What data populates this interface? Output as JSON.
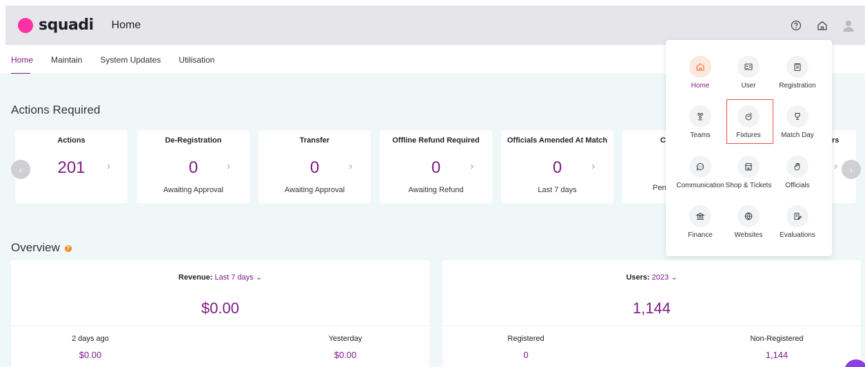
{
  "header": {
    "logo_text": "squadi",
    "title": "Home",
    "brand_color": "#ff2fa5",
    "icons": [
      "help-circle-icon",
      "home-icon",
      "user-avatar-icon"
    ]
  },
  "nav": {
    "tabs": [
      {
        "label": "Home",
        "active": true
      },
      {
        "label": "Maintain",
        "active": false
      },
      {
        "label": "System Updates",
        "active": false
      },
      {
        "label": "Utilisation",
        "active": false
      }
    ]
  },
  "actions": {
    "title": "Actions Required",
    "cards": [
      {
        "title": "Actions",
        "value": "201",
        "sub": ""
      },
      {
        "title": "De-Registration",
        "value": "0",
        "sub": "Awaiting Approval"
      },
      {
        "title": "Transfer",
        "value": "0",
        "sub": "Awaiting Approval"
      },
      {
        "title": "Offline Refund Required",
        "value": "0",
        "sub": "Awaiting Refund"
      },
      {
        "title": "Officials Amended At Match",
        "value": "0",
        "sub": "Last 7 days"
      },
      {
        "title": "Cl",
        "value": "",
        "sub": "Pen"
      },
      {
        "title": "rs",
        "value": "",
        "sub": ""
      }
    ]
  },
  "overview": {
    "title": "Overview",
    "revenue": {
      "label": "Revenue:",
      "period": "Last 7 days",
      "total": "$0.00",
      "stats": [
        {
          "label": "2 days ago",
          "value": "$0.00"
        },
        {
          "label": "Yesterday",
          "value": "$0.00"
        }
      ]
    },
    "users": {
      "label": "Users:",
      "period": "2023",
      "total": "1,144",
      "stats": [
        {
          "label": "Registered",
          "value": "0"
        },
        {
          "label": "Non-Registered",
          "value": "1,144"
        }
      ]
    }
  },
  "app_menu": {
    "items": [
      {
        "label": "Home",
        "icon": "home-icon",
        "active": true
      },
      {
        "label": "User",
        "icon": "id-card-icon",
        "active": false
      },
      {
        "label": "Registration",
        "icon": "clipboard-icon",
        "active": false
      },
      {
        "label": "Teams",
        "icon": "team-icon",
        "active": false
      },
      {
        "label": "Fixtures",
        "icon": "fixtures-ball-icon",
        "active": false,
        "highlighted": true
      },
      {
        "label": "Match Day",
        "icon": "trophy-icon",
        "active": false
      },
      {
        "label": "Communication",
        "icon": "chat-bubble-icon",
        "active": false
      },
      {
        "label": "Shop & Tickets",
        "icon": "shop-icon",
        "active": false
      },
      {
        "label": "Officials",
        "icon": "hand-icon",
        "active": false
      },
      {
        "label": "Finance",
        "icon": "bank-icon",
        "active": false
      },
      {
        "label": "Websites",
        "icon": "globe-icon",
        "active": false
      },
      {
        "label": "Evaluations",
        "icon": "edit-note-icon",
        "active": false
      }
    ]
  },
  "colors": {
    "accent": "#7e1b87",
    "highlight_border": "#e8503a",
    "help_badge": "#f08a24"
  }
}
